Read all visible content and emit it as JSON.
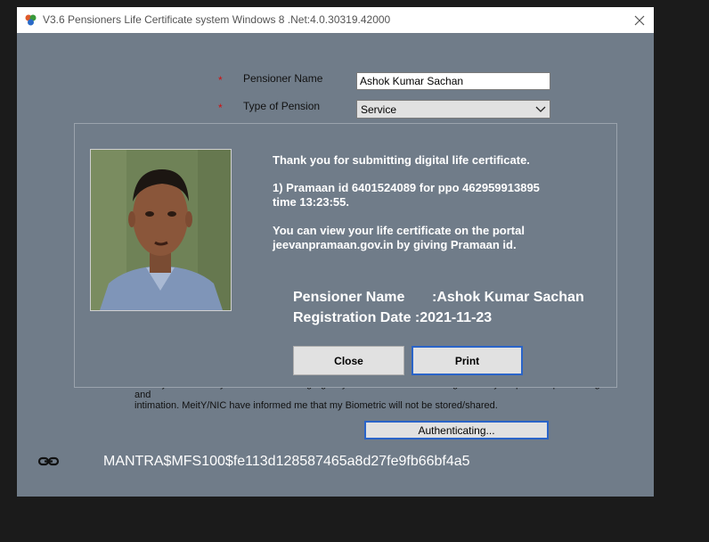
{
  "window": {
    "title": "V3.6 Pensioners Life Certificate system Windows 8 .Net:4.0.30319.42000"
  },
  "form": {
    "required_marker": "*",
    "pensioner_name_label": "Pensioner Name",
    "pensioner_name_value": "Ashok Kumar Sachan",
    "type_of_pension_label": "Type of Pension",
    "type_of_pension_value": "Service",
    "consent_line_1": "and my DLC with my Pension Disbursing Agency and Pension Sanctioning Authority for pension processing and",
    "consent_line_2": "intimation. MeitY/NIC have informed me that my Biometric will not be stored/shared.",
    "auth_button_label": "Authenticating...",
    "device_id": "MANTRA$MFS100$fe113d128587465a8d27fe9fb66bf4a5"
  },
  "modal": {
    "thank_you": "Thank you for submitting digital life certificate.",
    "pramaan_line_1": "1) Pramaan id 6401524089 for ppo 462959913895",
    "pramaan_line_2": "time 13:23:55.",
    "portal_line_1": "You can view your life certificate on the portal",
    "portal_line_2": "jeevanpramaan.gov.in by giving Pramaan id.",
    "name_label": "Pensioner Name",
    "name_value": ":Ashok Kumar Sachan",
    "reg_label": "Registration Date :2021-11-23",
    "close_label": "Close",
    "print_label": "Print"
  },
  "icons": {
    "app": "app-logo-icon",
    "close": "close-icon",
    "dropdown": "chevron-down-icon",
    "link": "link-icon"
  }
}
